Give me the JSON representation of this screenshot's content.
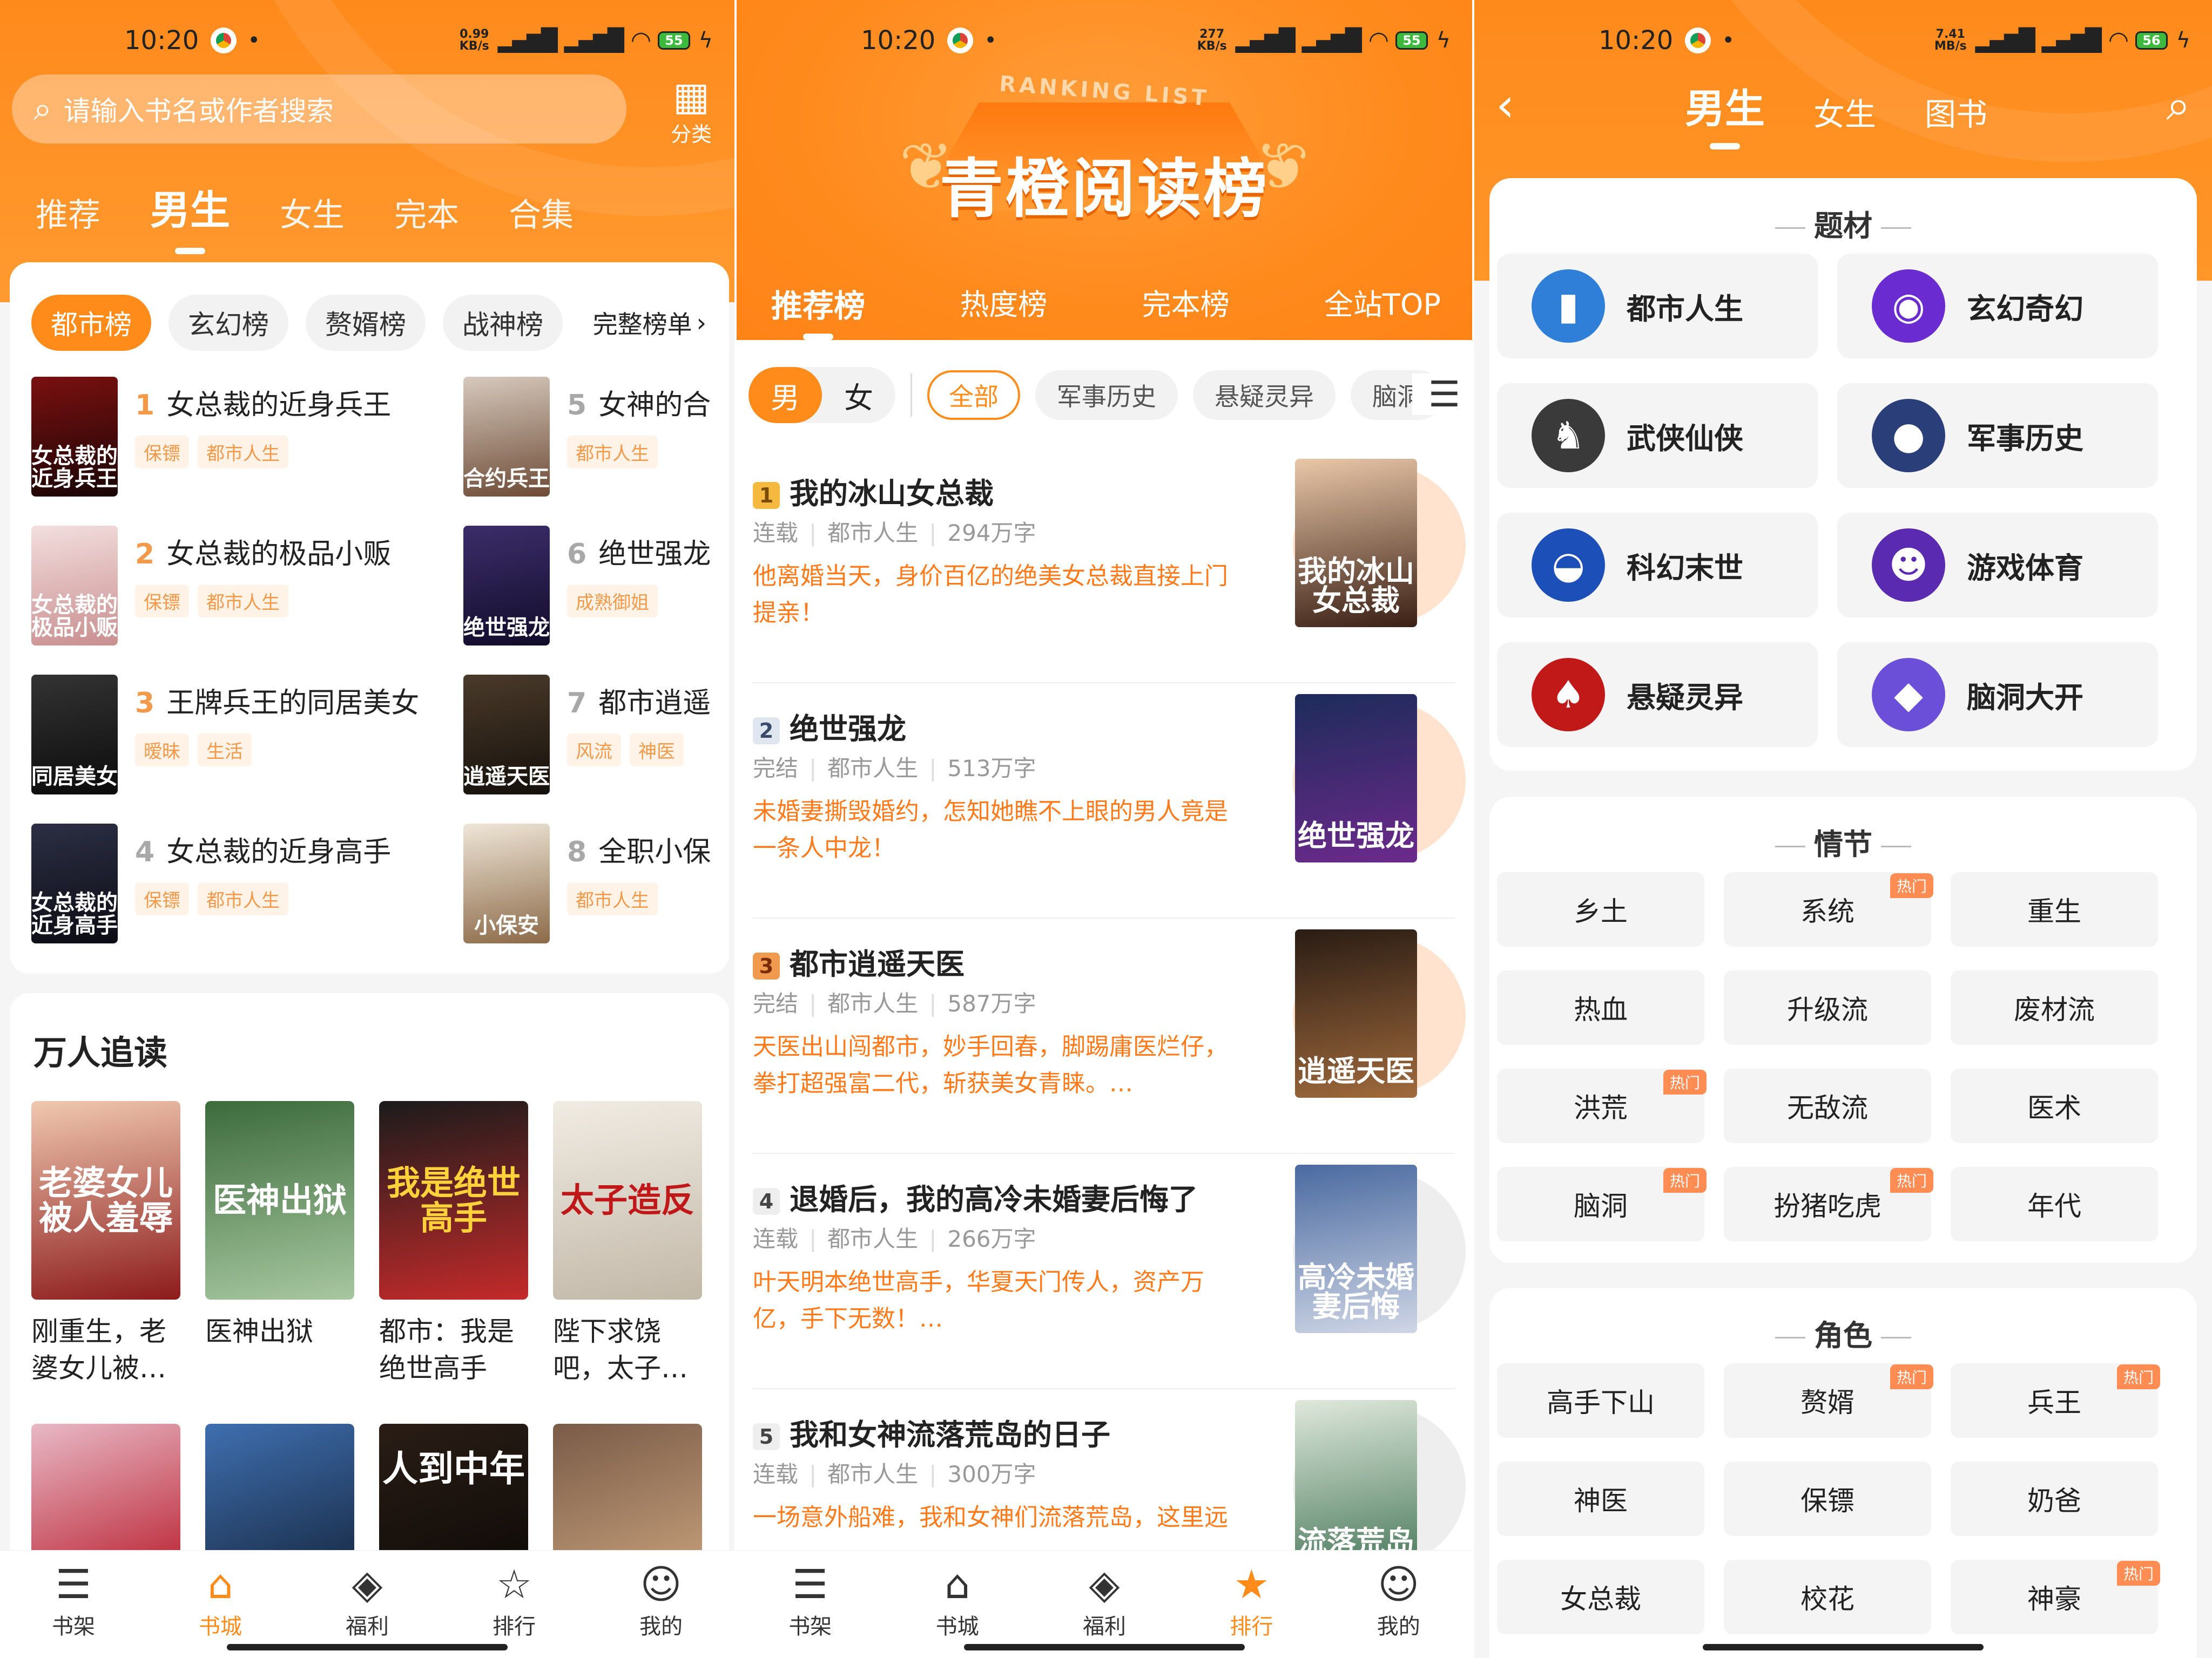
{
  "colors": {
    "accent": "#ff8c1a",
    "rank_gold": "#f39a4a",
    "desc": "#ff7a1a"
  },
  "statusbar": [
    {
      "time": "10:20",
      "speed_top": "0.99",
      "speed_unit": "KB/s",
      "battery": "55"
    },
    {
      "time": "10:20",
      "speed_top": "277",
      "speed_unit": "KB/s",
      "battery": "55"
    },
    {
      "time": "10:20",
      "speed_top": "7.41",
      "speed_unit": "MB/s",
      "battery": "56"
    }
  ],
  "screen1": {
    "search_placeholder": "请输入书名或作者搜索",
    "category_label": "分类",
    "tabs": [
      "推荐",
      "男生",
      "女生",
      "完本",
      "合集"
    ],
    "chips": [
      "都市榜",
      "玄幻榜",
      "赘婿榜",
      "战神榜"
    ],
    "full_list": "完整榜单",
    "ranks": [
      {
        "num": "1",
        "title": "女总裁的近身兵王",
        "tags": [
          "保镖",
          "都市人生"
        ],
        "cover": "女总裁的近身兵王"
      },
      {
        "num": "2",
        "title": "女总裁的极品小贩",
        "tags": [
          "保镖",
          "都市人生"
        ],
        "cover": "女总裁的极品小贩"
      },
      {
        "num": "3",
        "title": "王牌兵王的同居美女",
        "tags": [
          "暧昧",
          "生活"
        ],
        "cover": "同居美女"
      },
      {
        "num": "4",
        "title": "女总裁的近身高手",
        "tags": [
          "保镖",
          "都市人生"
        ],
        "cover": "女总裁的近身高手"
      },
      {
        "num": "5",
        "title": "女神的合",
        "tags": [
          "都市人生"
        ],
        "cover": "合约兵王"
      },
      {
        "num": "6",
        "title": "绝世强龙",
        "tags": [
          "成熟御姐"
        ],
        "cover": "绝世强龙"
      },
      {
        "num": "7",
        "title": "都市逍遥",
        "tags": [
          "风流",
          "神医"
        ],
        "cover": "逍遥天医"
      },
      {
        "num": "8",
        "title": "全职小保",
        "tags": [
          "都市人生"
        ],
        "cover": "小保安"
      }
    ],
    "popular_title": "万人追读",
    "popular": [
      {
        "name": "刚重生，老婆女儿被…",
        "cover": "老婆女儿被人羞辱"
      },
      {
        "name": "医神出狱",
        "cover": "医神出狱"
      },
      {
        "name": "都市：我是绝世高手",
        "cover": "我是绝世高手"
      },
      {
        "name": "陛下求饶吧，太子…",
        "cover": "太子造反"
      }
    ],
    "popular_row2_cover": "人到中年"
  },
  "screen2": {
    "banner_sub": "RANKING LIST",
    "banner_title": "青橙阅读榜",
    "tabs": [
      "推荐榜",
      "热度榜",
      "完本榜",
      "全站TOP"
    ],
    "sex": [
      "男",
      "女"
    ],
    "filters": [
      "全部",
      "军事历史",
      "悬疑灵异",
      "脑洞"
    ],
    "books": [
      {
        "rank": "1",
        "title": "我的冰山女总裁",
        "status": "连载",
        "genre": "都市人生",
        "words": "294万字",
        "desc": "他离婚当天，身价百亿的绝美女总裁直接上门提亲！",
        "cover": "我的冰山女总裁"
      },
      {
        "rank": "2",
        "title": "绝世强龙",
        "status": "完结",
        "genre": "都市人生",
        "words": "513万字",
        "desc": "未婚妻撕毁婚约，怎知她瞧不上眼的男人竟是一条人中龙！",
        "cover": "绝世强龙"
      },
      {
        "rank": "3",
        "title": "都市逍遥天医",
        "status": "完结",
        "genre": "都市人生",
        "words": "587万字",
        "desc": "天医出山闯都市，妙手回春，脚踢庸医烂仔，拳打超强富二代，斩获美女青睐。…",
        "cover": "逍遥天医"
      },
      {
        "rank": "4",
        "title": "退婚后，我的高冷未婚妻后悔了",
        "status": "连载",
        "genre": "都市人生",
        "words": "266万字",
        "desc": "叶天明本绝世高手，华夏天门传人，资产万亿，手下无数！…",
        "cover": "高冷未婚妻后悔"
      },
      {
        "rank": "5",
        "title": "我和女神流落荒岛的日子",
        "status": "连载",
        "genre": "都市人生",
        "words": "300万字",
        "desc": "一场意外船难，我和女神们流落荒岛，这里远",
        "cover": "流落荒岛"
      }
    ]
  },
  "screen3": {
    "tabs": [
      "男生",
      "女生",
      "图书"
    ],
    "sections": {
      "genre": "题材",
      "plot": "情节",
      "role": "角色"
    },
    "genres": [
      {
        "name": "都市人生",
        "icon": "building-icon",
        "color": "#2f7fd8",
        "glyph": "▮"
      },
      {
        "name": "玄幻奇幻",
        "icon": "wizard-hat-icon",
        "color": "#6a2bd0",
        "glyph": "◉"
      },
      {
        "name": "武侠仙侠",
        "icon": "warrior-helmet-icon",
        "color": "#3a3a3a",
        "glyph": "♞"
      },
      {
        "name": "军事历史",
        "icon": "soldier-icon",
        "color": "#2a3f7a",
        "glyph": "●"
      },
      {
        "name": "科幻末世",
        "icon": "ufo-icon",
        "color": "#1d4fb8",
        "glyph": "◒"
      },
      {
        "name": "游戏体育",
        "icon": "skull-bomb-icon",
        "color": "#5a2ab0",
        "glyph": "☻"
      },
      {
        "name": "悬疑灵异",
        "icon": "demon-icon",
        "color": "#c11818",
        "glyph": "♠"
      },
      {
        "name": "脑洞大开",
        "icon": "cube-icon",
        "color": "#6b4fd8",
        "glyph": "◆"
      }
    ],
    "plots": [
      {
        "name": "乡土",
        "hot": ""
      },
      {
        "name": "系统",
        "hot": "热门"
      },
      {
        "name": "重生",
        "hot": ""
      },
      {
        "name": "热血",
        "hot": ""
      },
      {
        "name": "升级流",
        "hot": ""
      },
      {
        "name": "废材流",
        "hot": ""
      },
      {
        "name": "洪荒",
        "hot": "热门"
      },
      {
        "name": "无敌流",
        "hot": ""
      },
      {
        "name": "医术",
        "hot": ""
      },
      {
        "name": "脑洞",
        "hot": "热门"
      },
      {
        "name": "扮猪吃虎",
        "hot": "热门"
      },
      {
        "name": "年代",
        "hot": ""
      }
    ],
    "roles": [
      {
        "name": "高手下山",
        "hot": ""
      },
      {
        "name": "赘婿",
        "hot": "热门"
      },
      {
        "name": "兵王",
        "hot": "热门"
      },
      {
        "name": "神医",
        "hot": ""
      },
      {
        "name": "保镖",
        "hot": ""
      },
      {
        "name": "奶爸",
        "hot": ""
      },
      {
        "name": "女总裁",
        "hot": ""
      },
      {
        "name": "校花",
        "hot": ""
      },
      {
        "name": "神豪",
        "hot": "热门"
      }
    ]
  },
  "bottom_nav": [
    "书架",
    "书城",
    "福利",
    "排行",
    "我的"
  ]
}
